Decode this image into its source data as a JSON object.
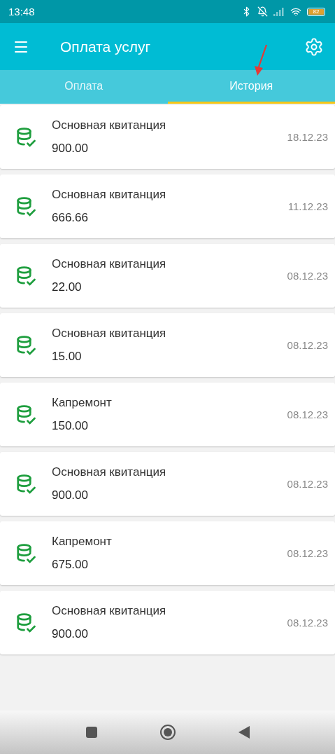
{
  "status_bar": {
    "time": "13:48",
    "battery": "82"
  },
  "app_bar": {
    "title": "Оплата услуг"
  },
  "tabs": [
    {
      "label": "Оплата",
      "selected": false
    },
    {
      "label": "История",
      "selected": true
    }
  ],
  "payments": [
    {
      "name": "Основная квитанция",
      "amount": "900.00",
      "date": "18.12.23"
    },
    {
      "name": "Основная квитанция",
      "amount": "666.66",
      "date": "11.12.23"
    },
    {
      "name": "Основная квитанция",
      "amount": "22.00",
      "date": "08.12.23"
    },
    {
      "name": "Основная квитанция",
      "amount": "15.00",
      "date": "08.12.23"
    },
    {
      "name": "Капремонт",
      "amount": "150.00",
      "date": "08.12.23"
    },
    {
      "name": "Основная квитанция",
      "amount": "900.00",
      "date": "08.12.23"
    },
    {
      "name": "Капремонт",
      "amount": "675.00",
      "date": "08.12.23"
    },
    {
      "name": "Основная квитанция",
      "amount": "900.00",
      "date": "08.12.23"
    }
  ]
}
